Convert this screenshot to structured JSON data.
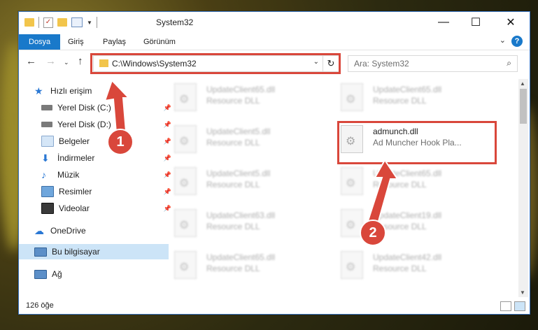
{
  "window": {
    "title": "System32"
  },
  "ribbon": {
    "tabs": [
      "Dosya",
      "Giriş",
      "Paylaş",
      "Görünüm"
    ],
    "help": "?"
  },
  "address": {
    "path": "C:\\Windows\\System32"
  },
  "search": {
    "placeholder": "Ara: System32"
  },
  "sidebar": {
    "items": [
      {
        "label": "Hızlı erişim",
        "pinned": false,
        "icon": "star-icon"
      },
      {
        "label": "Yerel Disk (C:)",
        "pinned": true,
        "icon": "drive-icon"
      },
      {
        "label": "Yerel Disk (D:)",
        "pinned": true,
        "icon": "drive-icon"
      },
      {
        "label": "Belgeler",
        "pinned": true,
        "icon": "documents-icon"
      },
      {
        "label": "İndirmeler",
        "pinned": true,
        "icon": "download-icon"
      },
      {
        "label": "Müzik",
        "pinned": true,
        "icon": "music-icon"
      },
      {
        "label": "Resimler",
        "pinned": true,
        "icon": "pictures-icon"
      },
      {
        "label": "Videolar",
        "pinned": true,
        "icon": "video-icon"
      },
      {
        "label": "OneDrive",
        "pinned": false,
        "icon": "cloud-icon"
      },
      {
        "label": "Bu bilgisayar",
        "pinned": false,
        "icon": "computer-icon"
      },
      {
        "label": "Ağ",
        "pinned": false,
        "icon": "network-icon"
      }
    ]
  },
  "files": [
    {
      "name": "UpdateClient65.dll",
      "type": "Resource DLL"
    },
    {
      "name": "UpdateClient65.dll",
      "type": "Resource DLL"
    },
    {
      "name": "UpdateClient5.dll",
      "type": "Resource DLL"
    },
    {
      "name": "admunch.dll",
      "type": "Ad Muncher Hook Pla..."
    },
    {
      "name": "UpdateClient5.dll",
      "type": "Resource DLL"
    },
    {
      "name": "UpdateClient65.dll",
      "type": "Resource DLL"
    },
    {
      "name": "UpdateClient63.dll",
      "type": "Resource DLL"
    },
    {
      "name": "UpdateClient19.dll",
      "type": "Resource DLL"
    },
    {
      "name": "UpdateClient65.dll",
      "type": "Resource DLL"
    },
    {
      "name": "UpdateClient42.dll",
      "type": "Resource DLL"
    }
  ],
  "status": {
    "count": "126 öğe"
  },
  "callouts": [
    "1",
    "2"
  ],
  "colors": {
    "accent": "#1979ca",
    "highlight": "#d9473b",
    "folder": "#f2c54b",
    "selection": "#cce4f7"
  }
}
